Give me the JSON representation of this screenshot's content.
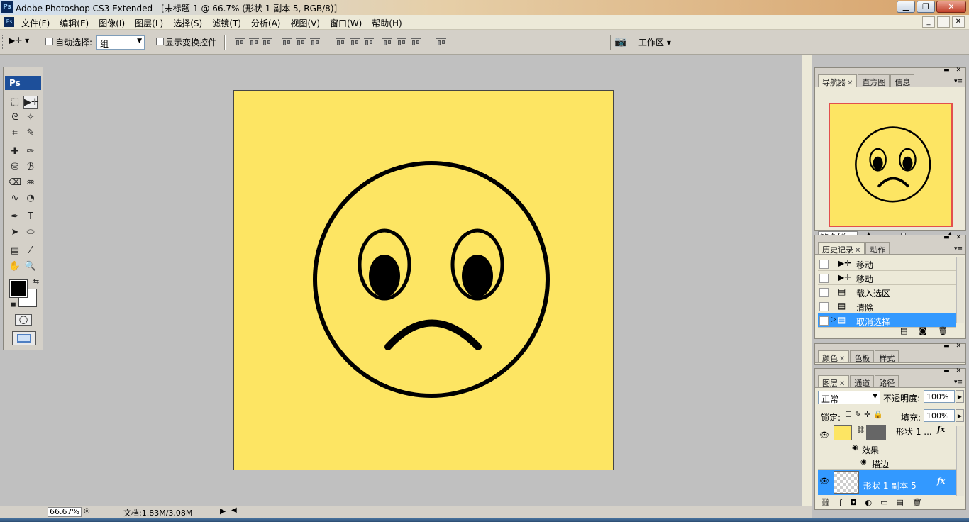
{
  "window": {
    "title": "Adobe Photoshop CS3 Extended - [未标题-1 @ 66.7% (形状 1 副本 5, RGB/8)]",
    "app_icon": "Ps",
    "buttons": [
      "minimize",
      "maximize",
      "close"
    ]
  },
  "menu": {
    "items": [
      "文件(F)",
      "编辑(E)",
      "图像(I)",
      "图层(L)",
      "选择(S)",
      "滤镜(T)",
      "分析(A)",
      "视图(V)",
      "窗口(W)",
      "帮助(H)"
    ]
  },
  "options": {
    "auto_select_label": "自动选择:",
    "auto_select_value": "组",
    "show_transform_label": "显示变换控件",
    "workspace_label": "工作区 ▾"
  },
  "toolbox": {
    "badge": "Ps",
    "foreground_color": "#000000",
    "background_color": "#ffffff"
  },
  "document": {
    "background_color": "#fde563",
    "stroke_color": "#000000"
  },
  "status": {
    "zoom": "66.67%",
    "doc_info": "文档:1.83M/3.08M"
  },
  "navigator": {
    "tabs": [
      "导航器",
      "直方图",
      "信息"
    ],
    "zoom": "66.67%"
  },
  "history": {
    "tabs": [
      "历史记录",
      "动作"
    ],
    "items": [
      {
        "label": "移动",
        "icon": "move-icon"
      },
      {
        "label": "移动",
        "icon": "move-icon"
      },
      {
        "label": "载入选区",
        "icon": "document-icon"
      },
      {
        "label": "清除",
        "icon": "document-icon"
      },
      {
        "label": "取消选择",
        "icon": "document-icon"
      }
    ],
    "selected_index": 4
  },
  "color_panel": {
    "tabs": [
      "颜色",
      "色板",
      "样式"
    ]
  },
  "layers": {
    "tabs": [
      "图层",
      "通道",
      "路径"
    ],
    "blend_mode": "正常",
    "opacity_label": "不透明度:",
    "opacity_value": "100%",
    "lock_label": "锁定:",
    "fill_label": "填充:",
    "fill_value": "100%",
    "rows": [
      {
        "name": "形状 1 ...",
        "fx": "fx"
      },
      {
        "name": "效果"
      },
      {
        "name": "描边"
      },
      {
        "name": "形状 1 副本 5",
        "fx": "fx"
      }
    ]
  }
}
